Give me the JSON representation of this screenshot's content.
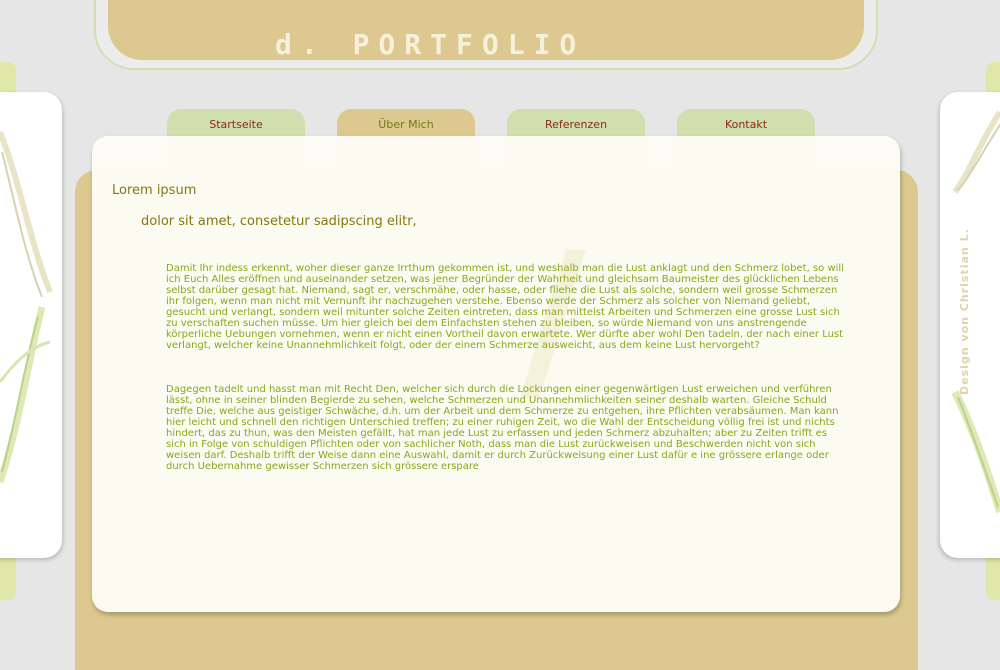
{
  "header": {
    "logo_text": "d. PORTFOLIO"
  },
  "nav": {
    "tabs": [
      {
        "label": "Startseite",
        "active": false
      },
      {
        "label": "Über Mich",
        "active": true
      },
      {
        "label": "Referenzen",
        "active": false
      },
      {
        "label": "Kontakt",
        "active": false
      }
    ]
  },
  "content": {
    "title": "Lorem ipsum",
    "subtitle": "dolor sit amet, consetetur sadipscing elitr,",
    "paragraphs": [
      "Damit Ihr indess erkennt, woher dieser ganze Irrthum gekommen ist, und weshalb man die Lust anklagt und den Schmerz lobet, so will ich Euch Alles eröffnen und auseinander setzen, was jener Begründer der Wahrheit und gleichsam Baumeister des glücklichen Lebens selbst darüber gesagt hat. Niemand, sagt er, verschmähe, oder hasse, oder fliehe die Lust als solche, sondern weil grosse Schmerzen ihr folgen, wenn man nicht mit Vernunft ihr nachzugehen verstehe. Ebenso werde der Schmerz als solcher von Niemand geliebt, gesucht und verlangt, sondern weil mitunter solche Zeiten eintreten, dass man mittelst Arbeiten und Schmerzen eine grosse Lust sich zu verschaften suchen müsse. Um hier gleich bei dem Einfachsten stehen zu bleiben, so würde Niemand von uns anstrengende körperliche Uebungen vornehmen, wenn er nicht einen Vortheil davon erwartete. Wer dürfte aber wohl Den tadeln, der nach einer Lust verlangt, welcher keine Unannehmlichkeit folgt, oder der einem Schmerze ausweicht, aus dem keine Lust hervorgeht?",
      "Dagegen tadelt und hasst man mit Recht Den, welcher sich durch die Lockungen einer gegenwärtigen Lust erweichen und verführen lässt, ohne in seiner blinden Begierde zu sehen, welche Schmerzen und Unannehmlichkeiten seiner deshalb warten. Gleiche Schuld treffe Die, welche aus geistiger Schwäche, d.h. um der Arbeit und dem Schmerze zu entgehen, ihre Pflichten verabsäumen. Man kann hier leicht und schnell den richtigen Unterschied treffen; zu einer ruhigen Zeit, wo die Wahl der Entscheidung völlig frei ist und nichts hindert, das zu thun, was den Meisten gefällt, hat man jede Lust zu erfassen und jeden Schmerz abzuhalten; aber zu Zeiten trifft es sich in Folge von schuldigen Pflichten oder von sachlicher Noth, dass man die Lust zurückweisen und Beschwerden nicht von sich weisen darf. Deshalb trifft der Weise dann eine Auswahl, damit er durch Zurückweisung einer Lust dafür e ine grössere erlange oder durch Uebernahme gewisser Schmerzen sich grössere erspare"
    ]
  },
  "credit": "Design von Christian L."
}
